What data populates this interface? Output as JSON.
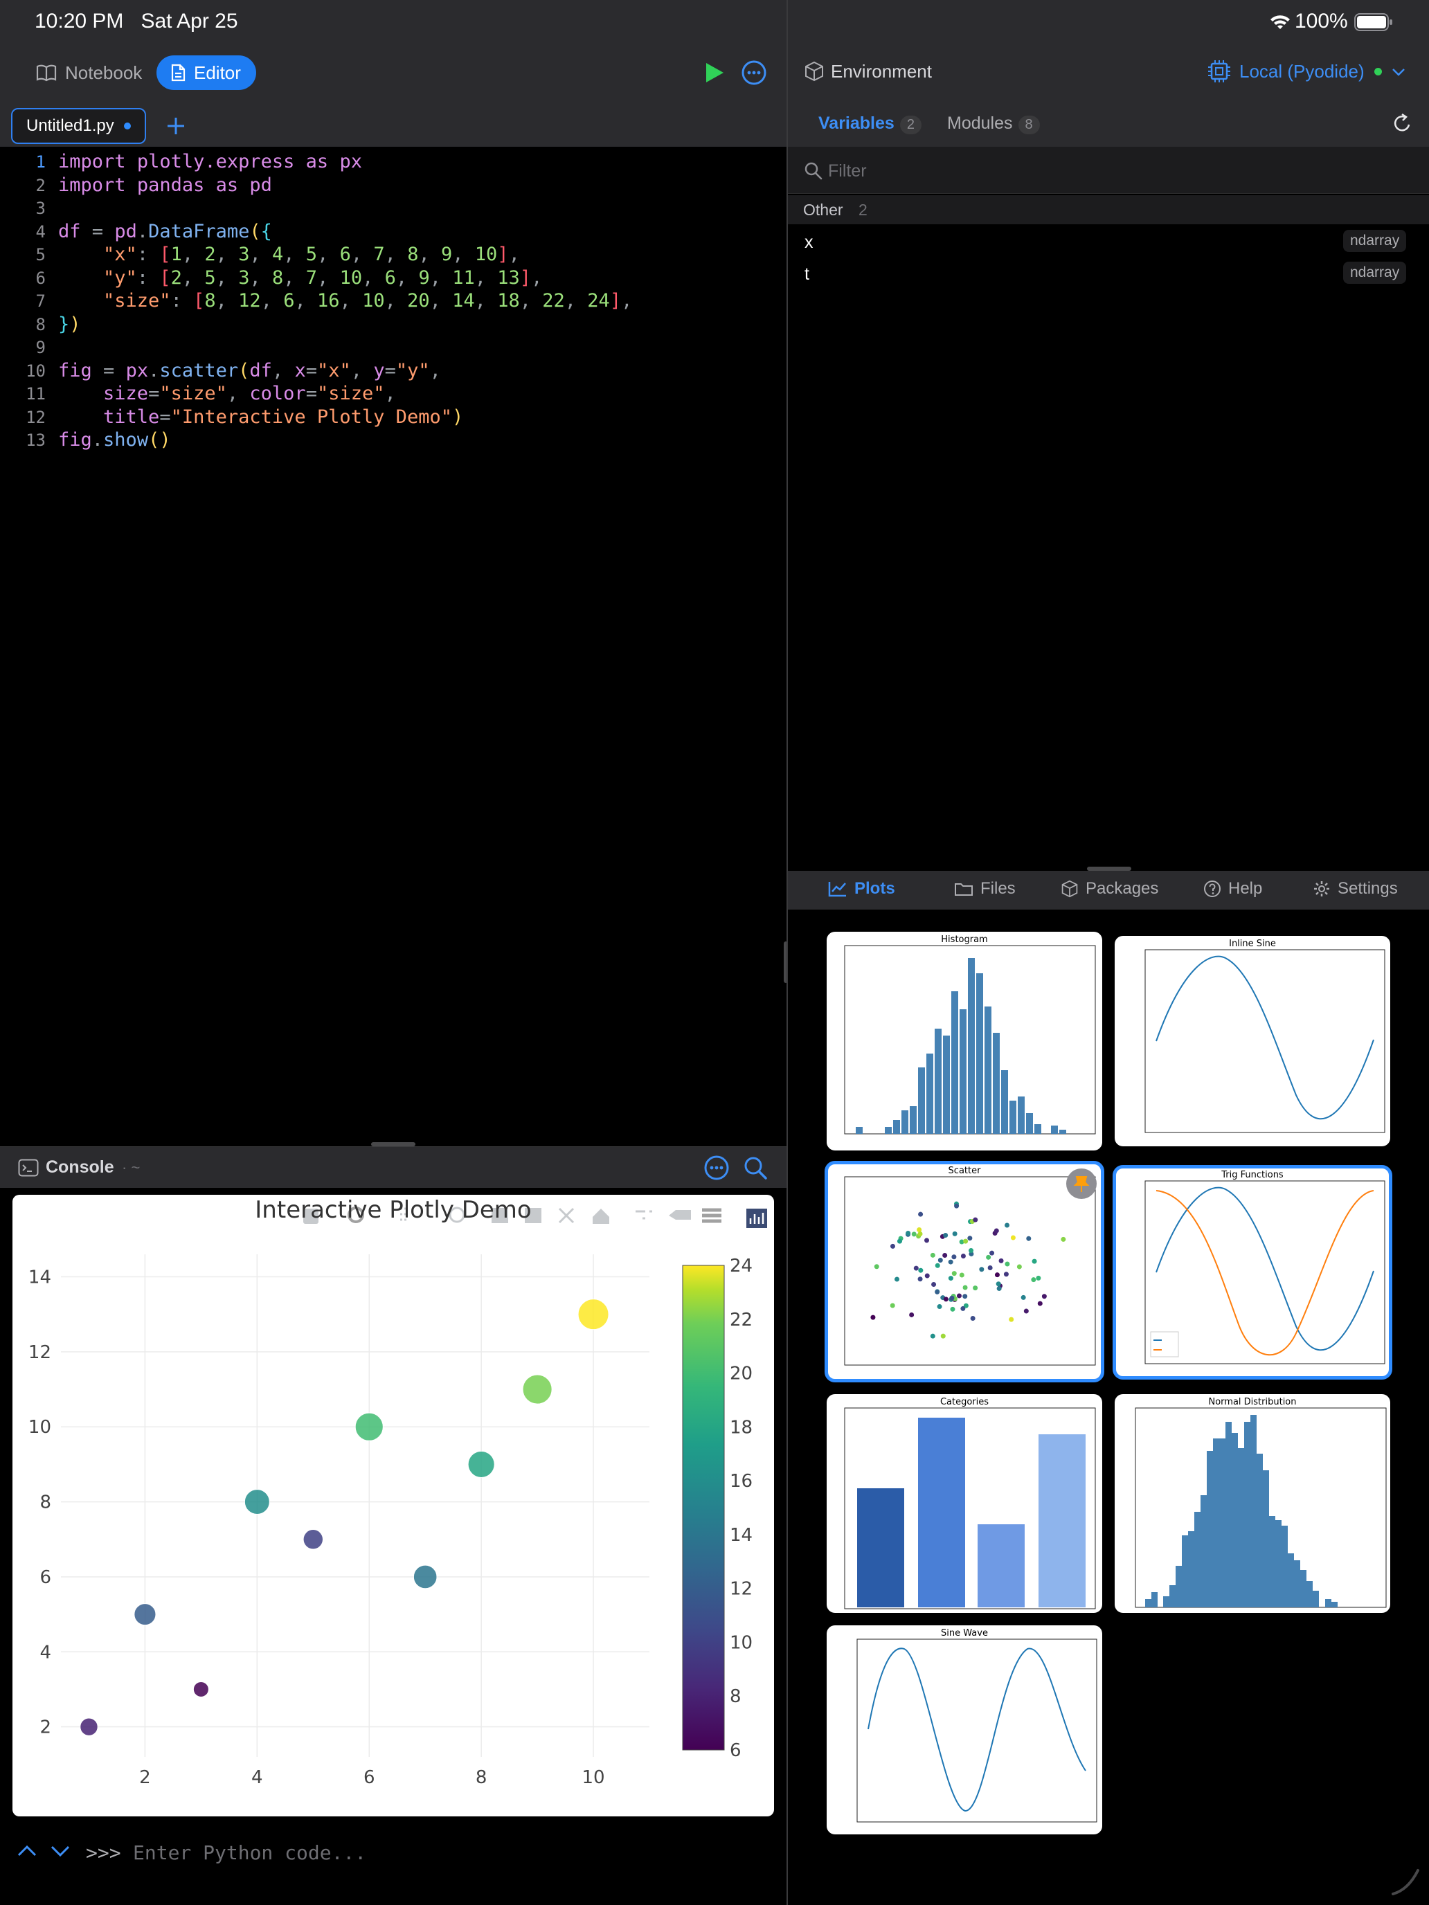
{
  "status": {
    "time": "10:20 PM",
    "date": "Sat Apr 25",
    "battery": "100%"
  },
  "toolbar": {
    "notebook_label": "Notebook",
    "editor_label": "Editor"
  },
  "file_tab": {
    "name": "Untitled1.py"
  },
  "editor": {
    "line_numbers": [
      "1",
      "2",
      "3",
      "4",
      "5",
      "6",
      "7",
      "8",
      "9",
      "10",
      "11",
      "12",
      "13"
    ]
  },
  "console": {
    "title": "Console",
    "path": "· ~",
    "prompt": ">>>",
    "input_placeholder": "Enter Python code..."
  },
  "plot": {
    "title": "Interactive Plotly Demo",
    "chart_data": {
      "type": "scatter",
      "title": "Interactive Plotly Demo",
      "x": [
        1,
        2,
        3,
        4,
        5,
        6,
        7,
        8,
        9,
        10
      ],
      "y": [
        2,
        5,
        3,
        8,
        7,
        10,
        6,
        9,
        11,
        13
      ],
      "size": [
        8,
        12,
        6,
        16,
        10,
        20,
        14,
        18,
        22,
        24
      ],
      "color": [
        8,
        12,
        6,
        16,
        10,
        20,
        14,
        18,
        22,
        24
      ],
      "xticks": [
        "2",
        "4",
        "6",
        "8",
        "10"
      ],
      "yticks": [
        "2",
        "4",
        "6",
        "8",
        "10",
        "12",
        "14"
      ],
      "colorbar_ticks": [
        "6",
        "8",
        "10",
        "12",
        "14",
        "16",
        "18",
        "20",
        "22",
        "24"
      ],
      "xlim": [
        0.5,
        11
      ],
      "ylim": [
        1.2,
        14.6
      ],
      "colorscale": "viridis",
      "colorbar_range": [
        6,
        24
      ],
      "grid": true
    }
  },
  "environment": {
    "title": "Environment",
    "runtime": "Local (Pyodide)",
    "tabs": [
      {
        "label": "Variables",
        "count": "2"
      },
      {
        "label": "Modules",
        "count": "8"
      }
    ],
    "filter_placeholder": "Filter",
    "group": {
      "label": "Other",
      "count": "2"
    },
    "variables": [
      {
        "name": "x",
        "type": "ndarray"
      },
      {
        "name": "t",
        "type": "ndarray"
      }
    ]
  },
  "bottom_tabs": [
    "Plots",
    "Files",
    "Packages",
    "Help",
    "Settings"
  ],
  "thumbnails": [
    {
      "title": "Histogram"
    },
    {
      "title": "Inline Sine"
    },
    {
      "title": "Scatter"
    },
    {
      "title": "Trig Functions"
    },
    {
      "title": "Categories"
    },
    {
      "title": "Normal Distribution"
    },
    {
      "title": "Sine Wave"
    }
  ],
  "colors": {
    "accent": "#1e7cf2",
    "run": "#30d158",
    "panel": "#2b2b2e"
  }
}
